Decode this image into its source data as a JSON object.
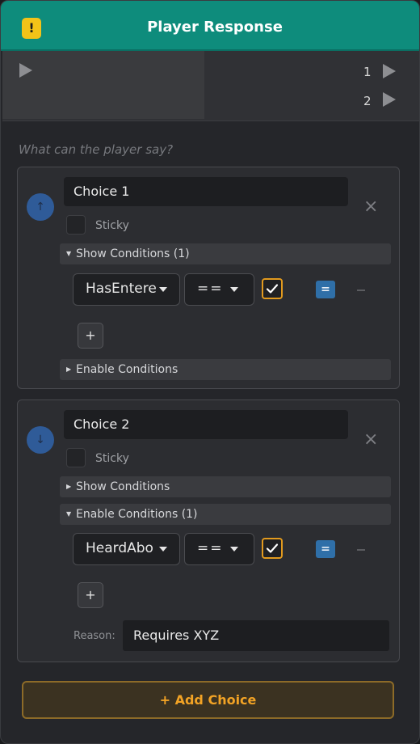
{
  "node": {
    "title": "Player Response",
    "warning_icon": "!",
    "colors": {
      "header": "#0e8c7c",
      "accent_orange": "#f2a325",
      "checkbox_border": "#e29a1e",
      "eq_button": "#2f6fa8"
    }
  },
  "ports": {
    "outputs": [
      "1",
      "2"
    ]
  },
  "prompt": "What can the player say?",
  "choices": [
    {
      "name": "Choice 1",
      "sticky_label": "Sticky",
      "sticky_checked": false,
      "arrow": "↑",
      "show_conditions": {
        "label": "Show Conditions (1)",
        "expanded": true
      },
      "enable_conditions": {
        "label": "Enable Conditions",
        "expanded": false
      },
      "condition": {
        "variable": "HasEntere",
        "operator": "==",
        "value_checked": true,
        "eq_label": "=",
        "add_label": "+"
      }
    },
    {
      "name": "Choice 2",
      "sticky_label": "Sticky",
      "sticky_checked": false,
      "arrow": "↓",
      "show_conditions": {
        "label": "Show Conditions",
        "expanded": false
      },
      "enable_conditions": {
        "label": "Enable Conditions (1)",
        "expanded": true
      },
      "condition": {
        "variable": "HeardAbo",
        "operator": "==",
        "value_checked": true,
        "eq_label": "=",
        "add_label": "+"
      },
      "reason": {
        "label": "Reason:",
        "value": "Requires XYZ"
      }
    }
  ],
  "add_choice_label": "+ Add Choice",
  "close_symbol": "×",
  "triangles": {
    "expanded": "▼",
    "collapsed": "▶"
  }
}
